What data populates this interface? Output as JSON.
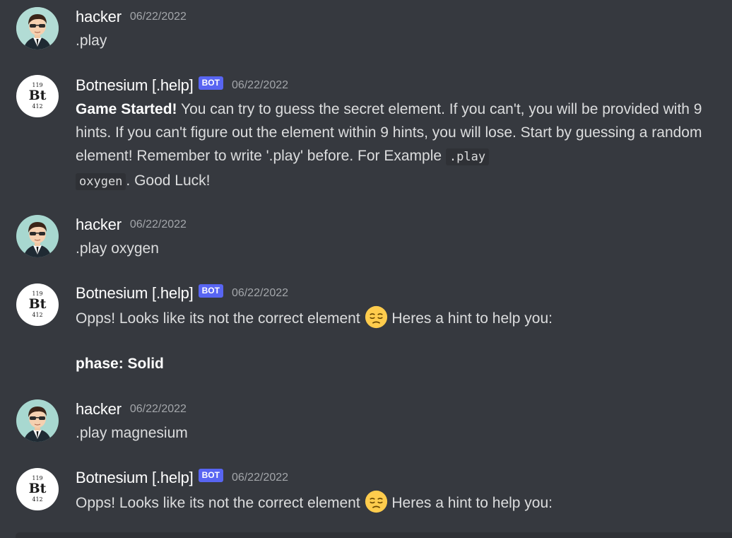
{
  "messages": [
    {
      "author": "hacker",
      "timestamp": "06/22/2022",
      "text": ".play"
    },
    {
      "author": "Botnesium [.help]",
      "badge": "BOT",
      "timestamp": "06/22/2022",
      "bold_prefix": "Game Started!",
      "text_before_code": " You can try to guess the secret element. If you can't, you will be provided with 9 hints. If you can't figure out the element within 9 hints, you will lose. Start by guessing a random element! Remember to write '.play' before. For Example ",
      "code_line1": ".play",
      "code_line2": "oxygen",
      "text_after_code": ". Good Luck!"
    },
    {
      "author": "hacker",
      "timestamp": "06/22/2022",
      "text": ".play oxygen"
    },
    {
      "author": "Botnesium [.help]",
      "badge": "BOT",
      "timestamp": "06/22/2022",
      "text_before_emoji": "Opps! Looks like its not the correct element ",
      "emoji": "pensive-face",
      "text_after_emoji": " Heres a hint to help you:",
      "hint": "phase: Solid"
    },
    {
      "author": "hacker",
      "timestamp": "06/22/2022",
      "text": ".play magnesium"
    },
    {
      "author": "Botnesium [.help]",
      "badge": "BOT",
      "timestamp": "06/22/2022",
      "text_before_emoji": "Opps! Looks like its not the correct element ",
      "emoji": "pensive-face",
      "text_after_emoji": " Heres a hint to help you:"
    }
  ],
  "bot_avatar": {
    "atomic_number": "119",
    "symbol": "Bt",
    "mass": "412"
  },
  "colors": {
    "background": "#36393f",
    "username": "#ffffff",
    "message_text": "#dcddde",
    "timestamp": "#a3a6aa",
    "bot_badge": "#5865f2",
    "code_bg": "#2f3136"
  }
}
